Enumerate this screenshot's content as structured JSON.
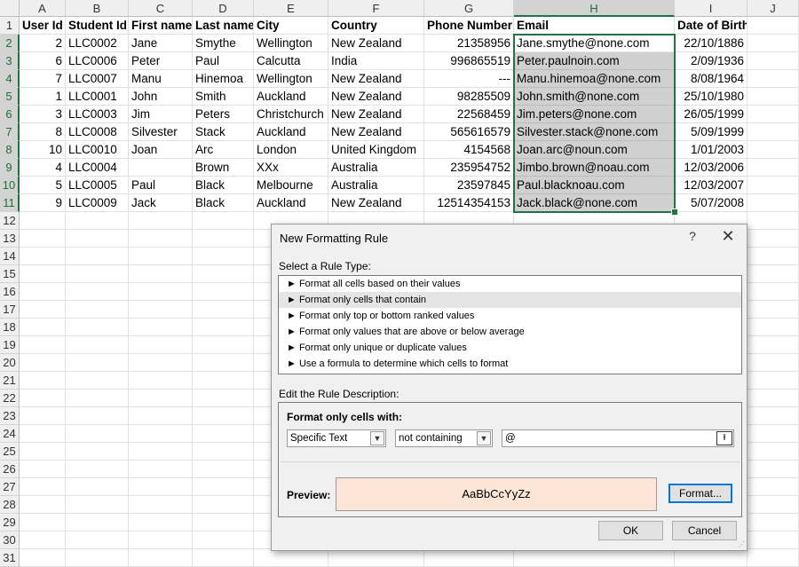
{
  "columns": [
    "A",
    "B",
    "C",
    "D",
    "E",
    "F",
    "G",
    "H",
    "I",
    "J"
  ],
  "rows": [
    "1",
    "2",
    "3",
    "4",
    "5",
    "6",
    "7",
    "8",
    "9",
    "10",
    "11",
    "12",
    "13",
    "14",
    "15",
    "16",
    "17",
    "18",
    "19",
    "20",
    "21",
    "22",
    "23",
    "24",
    "25",
    "26",
    "27",
    "28",
    "29",
    "30",
    "31"
  ],
  "headers": [
    "User Id",
    "Student Id",
    "First name",
    "Last name",
    "City",
    "Country",
    "Phone Number",
    "Email",
    "Date of Birth"
  ],
  "data": [
    [
      "2",
      "LLC0002",
      "Jane",
      "Smythe",
      "Wellington",
      "New Zealand",
      "21358956",
      "Jane.smythe@none.com",
      "22/10/1886"
    ],
    [
      "6",
      "LLC0006",
      "Peter",
      "Paul",
      "Calcutta",
      "India",
      "996865519",
      "Peter.paulnoin.com",
      "2/09/1936"
    ],
    [
      "7",
      "LLC0007",
      "Manu",
      "Hinemoa",
      "Wellington",
      "New Zealand",
      "---",
      "Manu.hinemoa@none.com",
      "8/08/1964"
    ],
    [
      "1",
      "LLC0001",
      "John",
      "Smith",
      "Auckland",
      "New Zealand",
      "98285509",
      "John.smith@none.com",
      "25/10/1980"
    ],
    [
      "3",
      "LLC0003",
      "Jim",
      "Peters",
      "Christchurch",
      "New Zealand",
      "22568459",
      "Jim.peters@none.com",
      "26/05/1999"
    ],
    [
      "8",
      "LLC0008",
      "Silvester",
      "Stack",
      "Auckland",
      "New Zealand",
      "565616579",
      "Silvester.stack@none.com",
      "5/09/1999"
    ],
    [
      "10",
      "LLC0010",
      "Joan",
      "Arc",
      "London",
      "United Kingdom",
      "4154568",
      "Joan.arc@noun.com",
      "1/01/2003"
    ],
    [
      "4",
      "LLC0004",
      "",
      "Brown",
      "XXx",
      "Australia",
      "235954752",
      "Jimbo.brown@noau.com",
      "12/03/2006"
    ],
    [
      "5",
      "LLC0005",
      "Paul",
      "Black",
      "Melbourne",
      "Australia",
      "23597845",
      "Paul.blacknoau.com",
      "12/03/2007"
    ],
    [
      "9",
      "LLC0009",
      "Jack",
      "Black",
      "Auckland",
      "New Zealand",
      "12514354153",
      "Jack.black@none.com",
      "5/07/2008"
    ]
  ],
  "dialog": {
    "title": "New Formatting Rule",
    "help": "?",
    "close": "✕",
    "select_label": "Select a Rule Type:",
    "rule_types": [
      "► Format all cells based on their values",
      "► Format only cells that contain",
      "► Format only top or bottom ranked values",
      "► Format only values that are above or below average",
      "► Format only unique or duplicate values",
      "► Use a formula to determine which cells to format"
    ],
    "edit_label": "Edit the Rule Description:",
    "format_only_label": "Format only cells with:",
    "condition_type": "Specific Text",
    "operator": "not containing",
    "value": "@",
    "preview_label": "Preview:",
    "preview_text": "AaBbCcYyZz",
    "format_button": "Format...",
    "ok_button": "OK",
    "cancel_button": "Cancel"
  },
  "colors": {
    "selection": "#217346",
    "preview_fill": "#fce4d6",
    "selected_range": "#d0d0d0"
  }
}
